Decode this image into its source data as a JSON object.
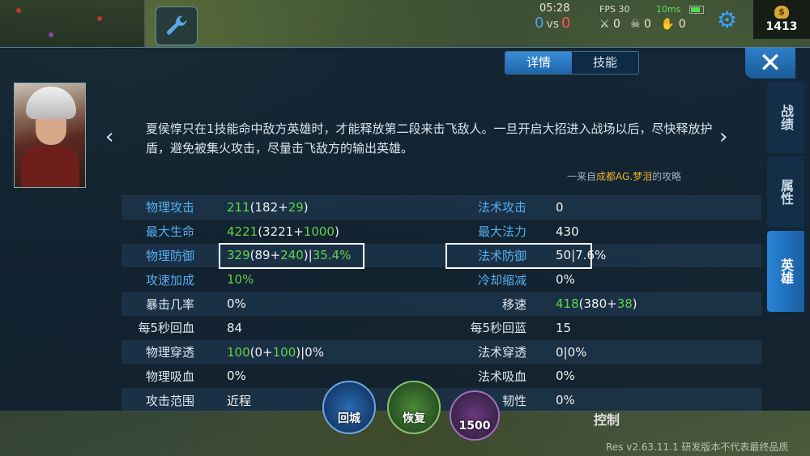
{
  "hud": {
    "time": "05:28",
    "score_blue": "0",
    "score_vs": "vs",
    "score_red": "0",
    "fps": "FPS 30",
    "ping": "10ms",
    "kills": "0",
    "deaths": "0",
    "assists": "0",
    "gold": "1413",
    "gold_icon": "$"
  },
  "tabs": [
    {
      "label": "详情",
      "active": true
    },
    {
      "label": "技能",
      "active": false
    }
  ],
  "close_icon": "✕",
  "description": "夏侯惇只在1技能命中敌方英雄时，才能释放第二段来击飞敌人。一旦开启大招进入战场以后，尽快释放护盾，避免被集火攻击，尽量击飞敌方的输出英雄。",
  "credit": {
    "prefix": "一来自",
    "author": "成都AG.梦泪",
    "suffix": "的攻略"
  },
  "arrows": {
    "left": "‹",
    "right": "›"
  },
  "stats": [
    {
      "label": "物理攻击",
      "label_color": "blue",
      "value_main": "211",
      "value_paren_open": "(182+",
      "value_green": "29",
      "value_tail": ")",
      "label2": "法术攻击",
      "label2_color": "blue",
      "value2_main": "0",
      "value2_green": "",
      "value2_tail": ""
    },
    {
      "label": "最大生命",
      "label_color": "blue",
      "value_main": "4221",
      "value_paren_open": "(3221+",
      "value_green": "1000",
      "value_tail": ")",
      "label2": "最大法力",
      "label2_color": "blue",
      "value2_main": "430",
      "value2_green": "",
      "value2_tail": ""
    },
    {
      "label": "物理防御",
      "label_color": "blue",
      "value_main": "329",
      "value_paren_open": "(89+",
      "value_green": "240",
      "value_tail": ")|35.4%",
      "label2": "法术防御",
      "label2_color": "blue",
      "value2_main": "50|7.6%",
      "value2_green": "",
      "value2_tail": ""
    },
    {
      "label": "攻速加成",
      "label_color": "blue",
      "value_main": "10%",
      "value_paren_open": "",
      "value_green": "",
      "value_tail": "",
      "label2": "冷却缩减",
      "label2_color": "blue",
      "value2_main": "0%",
      "value2_green": "",
      "value2_tail": ""
    },
    {
      "label": "暴击几率",
      "label_color": "white",
      "value_main": "0%",
      "value_paren_open": "",
      "value_green": "",
      "value_tail": "",
      "label2": "移速",
      "label2_color": "white",
      "value2_main": "418",
      "value2_paren_open": "(380+",
      "value2_green": "38",
      "value2_tail": ")"
    },
    {
      "label": "每5秒回血",
      "label_color": "white",
      "value_main": "84",
      "value_paren_open": "",
      "value_green": "",
      "value_tail": "",
      "label2": "每5秒回蓝",
      "label2_color": "white",
      "value2_main": "15",
      "value2_green": "",
      "value2_tail": ""
    },
    {
      "label": "物理穿透",
      "label_color": "white",
      "value_main": "100",
      "value_paren_open": "(0+",
      "value_green": "100",
      "value_tail": ")|0%",
      "label2": "法术穿透",
      "label2_color": "white",
      "value2_main": "0|0%",
      "value2_green": "",
      "value2_tail": ""
    },
    {
      "label": "物理吸血",
      "label_color": "white",
      "value_main": "0%",
      "value_paren_open": "",
      "value_green": "",
      "value_tail": "",
      "label2": "法术吸血",
      "label2_color": "white",
      "value2_main": "0%",
      "value2_green": "",
      "value2_tail": ""
    },
    {
      "label": "攻击范围",
      "label_color": "white",
      "value_main": "近程",
      "value_paren_open": "",
      "value_green": "",
      "value_tail": "",
      "label2": "韧性",
      "label2_color": "white",
      "value2_main": "0%",
      "value2_green": "",
      "value2_tail": ""
    }
  ],
  "side_tabs": [
    {
      "label": "战绩",
      "active": false
    },
    {
      "label": "属性",
      "active": false
    },
    {
      "label": "英雄",
      "active": true
    }
  ],
  "skills": {
    "recall": "回城",
    "heal": "恢复",
    "ult_cost": "1500",
    "control": "控制"
  },
  "version": "Res v2.63.11.1 研发版本不代表最终品质"
}
